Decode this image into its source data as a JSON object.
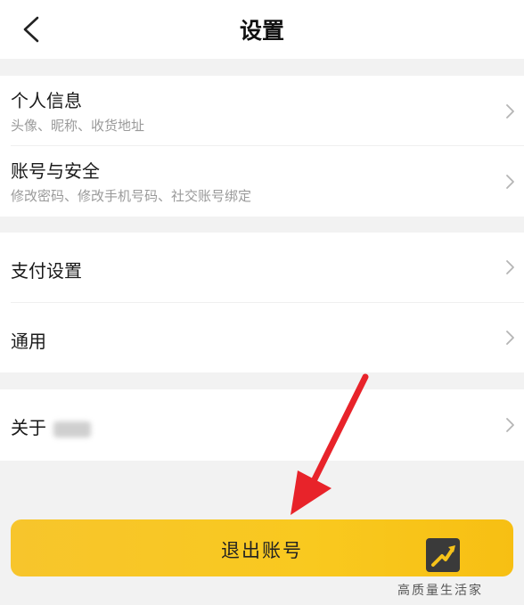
{
  "header": {
    "title": "设置",
    "back_icon": "chevron-left-icon"
  },
  "groups": [
    {
      "items": [
        {
          "title": "个人信息",
          "subtitle": "头像、昵称、收货地址"
        },
        {
          "title": "账号与安全",
          "subtitle": "修改密码、修改手机号码、社交账号绑定"
        }
      ]
    },
    {
      "items": [
        {
          "title": "支付设置"
        },
        {
          "title": "通用"
        }
      ]
    },
    {
      "items": [
        {
          "title": "关于"
        }
      ]
    }
  ],
  "logout": {
    "label": "退出账号"
  },
  "watermark": {
    "text": "高质量生活家"
  },
  "colors": {
    "accent": "#f9c91f",
    "arrow": "#e8232a",
    "background": "#f2f2f2"
  }
}
